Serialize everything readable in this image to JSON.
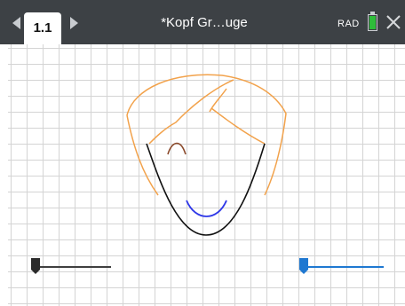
{
  "toolbar": {
    "tab_label": "1.1",
    "document_title": "*Kopf Gr…uge",
    "angle_mode": "RAD"
  },
  "icons": {
    "prev_page": "chevron-left-icon",
    "next_page": "chevron-right-icon",
    "battery": "battery-icon",
    "close": "close-icon"
  },
  "sliders": {
    "left": {
      "value": 0
    },
    "right": {
      "value": 0
    }
  },
  "colors": {
    "topbar": "#3d4145",
    "hair": "#f2a24b",
    "face": "#111111",
    "eyebrow": "#8b4a2b",
    "mouth": "#2f38e8",
    "slider_left": "#3f3f3f",
    "slider_right": "#1f78d1",
    "battery": "#2ebd3a"
  }
}
